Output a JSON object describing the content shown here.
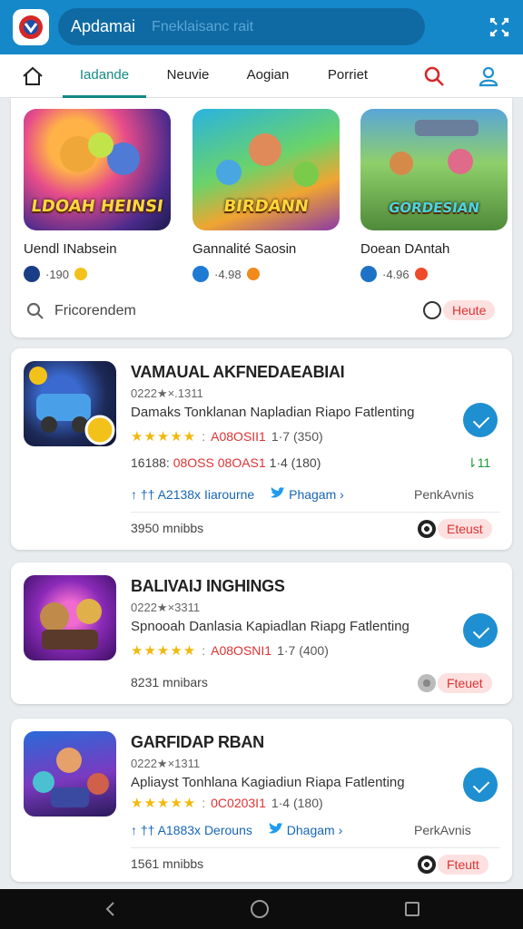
{
  "colors": {
    "brand": "#1588c9",
    "accent_tab": "#138a86",
    "download": "#1e8fd0",
    "badge_red": "#d33"
  },
  "header": {
    "title": "Apdamai",
    "search_placeholder": "Fneklaisanc rait"
  },
  "tabs": [
    {
      "label": "Iadande",
      "active": true
    },
    {
      "label": "Neuvie"
    },
    {
      "label": "Aogian"
    },
    {
      "label": "Porriet"
    }
  ],
  "featured": {
    "items": [
      {
        "thumb_text": "LDOAH HEINSI",
        "name": "Uendl INabsein",
        "rating": "·190",
        "badge_color": "#1a3e86",
        "coin_color": "#f3c21a"
      },
      {
        "thumb_text": "BIRDANN",
        "name": "Gannalité Saosin",
        "rating": "·4.98",
        "badge_color": "#1e7bd3",
        "coin_color": "#f08b1b"
      },
      {
        "thumb_text": "GORDESIAN",
        "name": "Doean DAntah",
        "rating": "·4.96",
        "badge_color": "#1e72c5",
        "coin_color": "#ee4a2a"
      }
    ],
    "search_label": "Fricorendem",
    "toggle_label": "Heute"
  },
  "cards": [
    {
      "title": "VAMAUAL AKFNEDAEABIAI",
      "sub": "0222★×.1311",
      "desc": "Damaks Tonklanan Napladian Riapo Fatlenting",
      "stars": "★★★★★",
      "stars_text": "A08OSII1",
      "stars_count": "1·7 (350)",
      "line2_prefix": "16188:",
      "line2_red": "08OSS 08OAS1",
      "line2_count": "1·4 (180)",
      "count_badge": "⇂11",
      "share_a": "↑ †† A2138x Iiarourne",
      "share_b": "Phagam ›",
      "perk": "PenkAvnis",
      "footer_text": "3950 mnibbs",
      "toggle_label": "Eteust"
    },
    {
      "title": "BALIVAIJ INGHINGS",
      "sub": "0222★×3311",
      "desc": "Spnooah Danlasia Kapiadlan Riapg Fatlenting",
      "stars": "★★★★★",
      "stars_text": "A08OSNI1",
      "stars_count": "1·7 (400)",
      "footer_text": "8231 mnibars",
      "toggle_label": "Fteuet"
    },
    {
      "title": "GARFIDAP RBAN",
      "sub": "0222★×1311",
      "desc": "Apliayst Tonhlana Kagiadiun Riapa Fatlenting",
      "stars": "★★★★★",
      "stars_text": "0C0203I1",
      "stars_count": "1·4 (180)",
      "share_a": "↑ †† A1883x Derouns",
      "share_b": "Dhagam ›",
      "perk": "PerkAvnis",
      "footer_text": "1561 mnibbs",
      "toggle_label": "Fteutt"
    }
  ]
}
